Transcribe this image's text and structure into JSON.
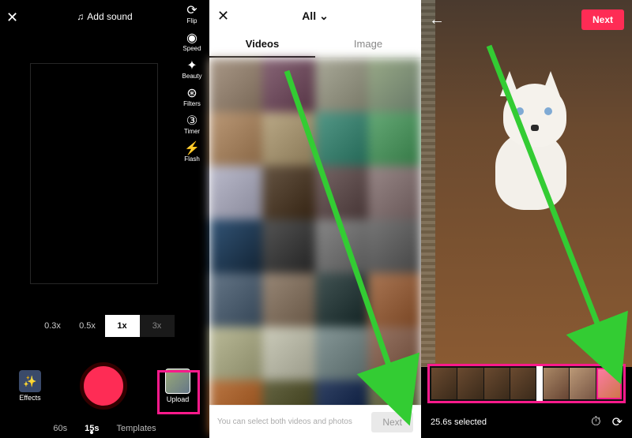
{
  "panel1": {
    "close_label": "✕",
    "sound_label": "Add sound",
    "tools": [
      {
        "icon": "⟳",
        "label": "Flip"
      },
      {
        "icon": "◉",
        "label": "Speed"
      },
      {
        "icon": "✦",
        "label": "Beauty"
      },
      {
        "icon": "⊛",
        "label": "Filters"
      },
      {
        "icon": "③",
        "label": "Timer"
      },
      {
        "icon": "⚡",
        "label": "Flash"
      }
    ],
    "zooms": [
      "0.3x",
      "0.5x",
      "1x",
      "3x"
    ],
    "zoom_active_index": 2,
    "effects_label": "Effects",
    "upload_label": "Upload",
    "tabs": [
      "60s",
      "15s",
      "Templates"
    ],
    "tab_active_index": 1
  },
  "panel2": {
    "close_label": "✕",
    "all_label": "All",
    "tabs": [
      "Videos",
      "Image"
    ],
    "tab_active_index": 0,
    "hint_text": "You can select both videos and photos",
    "next_label": "Next"
  },
  "panel3": {
    "back_label": "←",
    "next_label": "Next",
    "selected_text": "25.6s selected"
  },
  "colors": {
    "accent": "#fe2c55",
    "highlight": "#ff1a8c",
    "arrow": "#33cc33"
  }
}
